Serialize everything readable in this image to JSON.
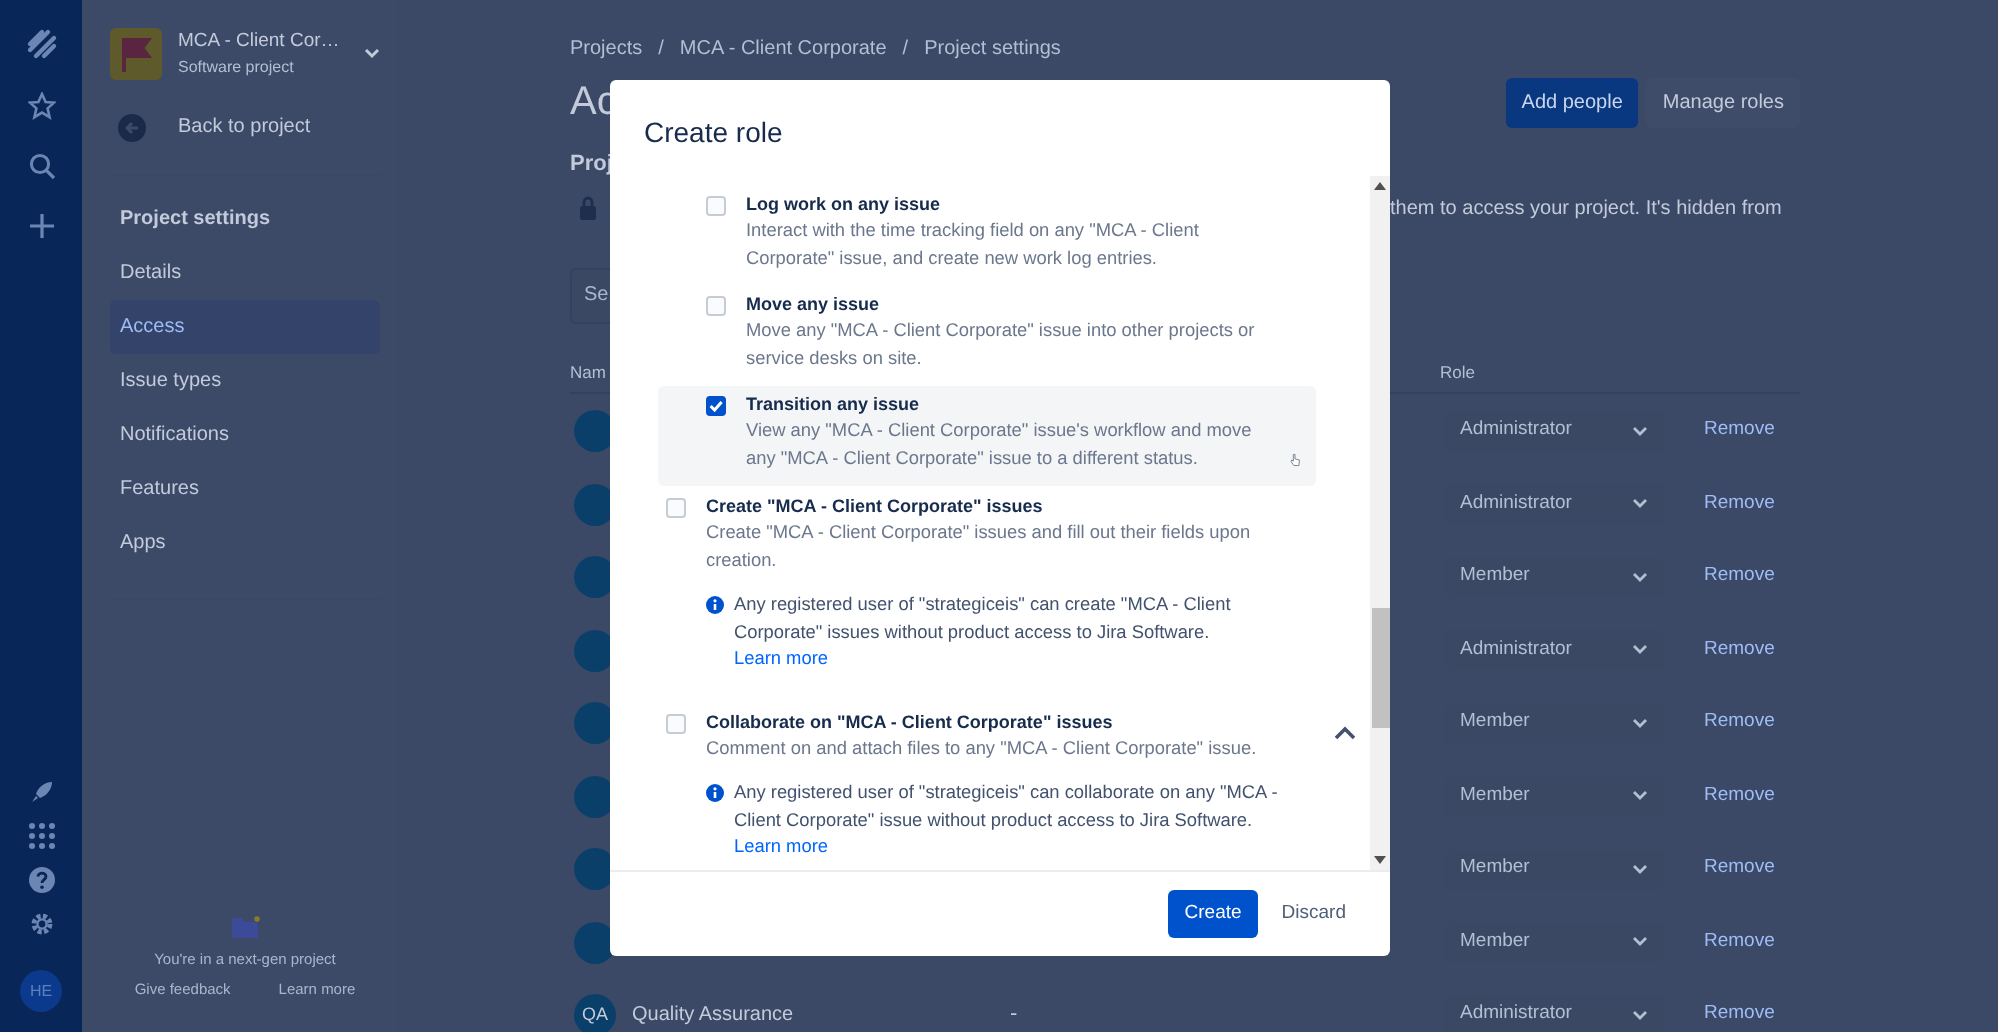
{
  "global_nav": {
    "avatar": "HE"
  },
  "sidebar": {
    "project_name": "MCA - Client Cor…",
    "project_type": "Software project",
    "back": "Back to project",
    "section": "Project settings",
    "items": [
      {
        "label": "Details",
        "selected": false
      },
      {
        "label": "Access",
        "selected": true
      },
      {
        "label": "Issue types",
        "selected": false
      },
      {
        "label": "Notifications",
        "selected": false
      },
      {
        "label": "Features",
        "selected": false
      },
      {
        "label": "Apps",
        "selected": false
      }
    ],
    "footer": {
      "text": "You're in a next-gen project",
      "links": [
        "Give feedback",
        "Learn more"
      ]
    }
  },
  "page": {
    "breadcrumbs": [
      "Projects",
      "MCA - Client Corporate",
      "Project settings"
    ],
    "breadcrumb_separator": "/",
    "heading": "Ac",
    "buttons": [
      {
        "label": "Add people",
        "kind": "primary"
      },
      {
        "label": "Manage roles",
        "kind": "subtle"
      }
    ],
    "subheading": "Proj",
    "note": "them to access your project. It's hidden from",
    "search": {
      "placeholder": "Se"
    },
    "columns": [
      "Nam",
      "Role"
    ],
    "rows": [
      {
        "role": "Administrator",
        "action": "Remove"
      },
      {
        "role": "Administrator",
        "action": "Remove"
      },
      {
        "role": "Member",
        "action": "Remove"
      },
      {
        "role": "Administrator",
        "action": "Remove"
      },
      {
        "role": "Member",
        "action": "Remove"
      },
      {
        "role": "Member",
        "action": "Remove"
      },
      {
        "role": "Member",
        "action": "Remove"
      },
      {
        "role": "Member",
        "action": "Remove"
      },
      {
        "initials": "QA",
        "name": "Quality Assurance",
        "detail": "-",
        "role": "Administrator",
        "action": "Remove"
      }
    ]
  },
  "modal": {
    "title": "Create role",
    "sub_permissions": [
      {
        "label": "Log work on any issue",
        "description": "Interact with the time tracking field on any \"MCA - Client Corporate\" issue, and create new work log entries.",
        "checked": false,
        "highlighted": false
      },
      {
        "label": "Move any issue",
        "description": "Move any \"MCA - Client Corporate\" issue into other projects or service desks on site.",
        "checked": false,
        "highlighted": false
      },
      {
        "label": "Transition any issue",
        "description": "View any \"MCA - Client Corporate\" issue's workflow and move any \"MCA - Client Corporate\" issue to a different status.",
        "checked": true,
        "highlighted": true
      }
    ],
    "permissions": [
      {
        "label": "Create \"MCA - Client Corporate\" issues",
        "description": "Create \"MCA - Client Corporate\" issues and fill out their fields upon creation.",
        "checked": false,
        "info": {
          "text": "Any registered user of \"strategiceis\" can create \"MCA - Client Corporate\" issues without product access to Jira Software.",
          "link": "Learn more"
        }
      },
      {
        "label": "Collaborate on \"MCA - Client Corporate\" issues",
        "description": "Comment on and attach files to any \"MCA - Client Corporate\" issue.",
        "checked": false,
        "expanded": true,
        "info": {
          "text": "Any registered user of \"strategiceis\" can collaborate on any \"MCA - Client Corporate\" issue without product access to Jira Software.",
          "link": "Learn more"
        }
      }
    ],
    "buttons": [
      {
        "label": "Create",
        "kind": "primary"
      },
      {
        "label": "Discard",
        "kind": "subtle"
      }
    ]
  }
}
